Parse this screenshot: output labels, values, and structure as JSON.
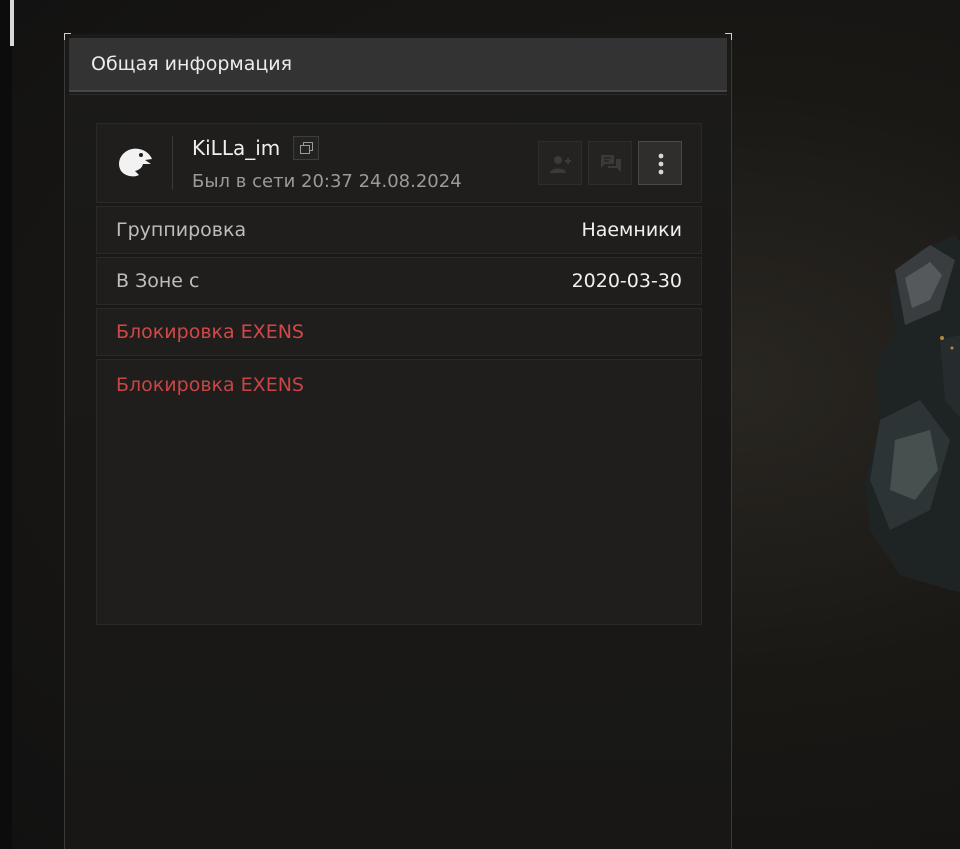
{
  "panel": {
    "title": "Общая информация"
  },
  "profile": {
    "username": "KiLLa_im",
    "status": "Был в сети 20:37 24.08.2024",
    "avatar_icon": "eagle-head-icon",
    "actions": [
      {
        "name": "add-friend",
        "icon": "add-user-icon"
      },
      {
        "name": "message",
        "icon": "chat-icon"
      },
      {
        "name": "more",
        "icon": "more-vertical-icon"
      }
    ]
  },
  "rows": [
    {
      "label": "Группировка",
      "value": "Наемники"
    },
    {
      "label": "В Зоне с",
      "value": "2020-03-30"
    }
  ],
  "ban": {
    "title": "Блокировка EXENS",
    "text": "Блокировка EXENS",
    "color": "#d04848"
  }
}
